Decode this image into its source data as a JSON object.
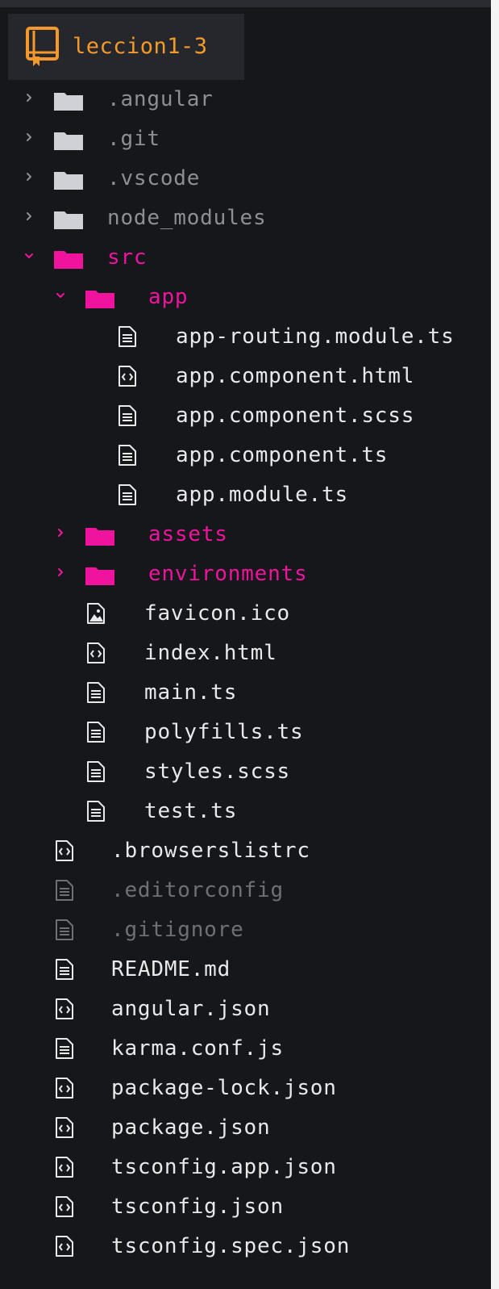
{
  "project": {
    "name": "leccion1-3",
    "icon": "repo-book-icon",
    "accent_color": "#f59a2a"
  },
  "colors": {
    "background": "#16171b",
    "folder_open": "#f0139d",
    "folder_closed": "#8e8f96",
    "file_text": "#e9e9ec",
    "ignored_text": "#6f7077"
  },
  "tree": [
    {
      "label": ".angular",
      "type": "folder",
      "expanded": false,
      "depth": 0,
      "style": "dim"
    },
    {
      "label": ".git",
      "type": "folder",
      "expanded": false,
      "depth": 0,
      "style": "dim"
    },
    {
      "label": ".vscode",
      "type": "folder",
      "expanded": false,
      "depth": 0,
      "style": "dim"
    },
    {
      "label": "node_modules",
      "type": "folder",
      "expanded": false,
      "depth": 0,
      "style": "dim"
    },
    {
      "label": "src",
      "type": "folder",
      "expanded": true,
      "depth": 0,
      "style": "pink"
    },
    {
      "label": "app",
      "type": "folder",
      "expanded": true,
      "depth": 1,
      "style": "pink"
    },
    {
      "label": "app-routing.module.ts",
      "type": "file",
      "icon": "text-file-icon",
      "depth": 2,
      "style": "white"
    },
    {
      "label": "app.component.html",
      "type": "file",
      "icon": "code-file-icon",
      "depth": 2,
      "style": "white"
    },
    {
      "label": "app.component.scss",
      "type": "file",
      "icon": "text-file-icon",
      "depth": 2,
      "style": "white"
    },
    {
      "label": "app.component.ts",
      "type": "file",
      "icon": "text-file-icon",
      "depth": 2,
      "style": "white"
    },
    {
      "label": "app.module.ts",
      "type": "file",
      "icon": "text-file-icon",
      "depth": 2,
      "style": "white"
    },
    {
      "label": "assets",
      "type": "folder",
      "expanded": false,
      "depth": 1,
      "style": "pink"
    },
    {
      "label": "environments",
      "type": "folder",
      "expanded": false,
      "depth": 1,
      "style": "pink"
    },
    {
      "label": "favicon.ico",
      "type": "file",
      "icon": "image-file-icon",
      "depth": 1,
      "style": "white"
    },
    {
      "label": "index.html",
      "type": "file",
      "icon": "code-file-icon",
      "depth": 1,
      "style": "white"
    },
    {
      "label": "main.ts",
      "type": "file",
      "icon": "text-file-icon",
      "depth": 1,
      "style": "white"
    },
    {
      "label": "polyfills.ts",
      "type": "file",
      "icon": "text-file-icon",
      "depth": 1,
      "style": "white"
    },
    {
      "label": "styles.scss",
      "type": "file",
      "icon": "text-file-icon",
      "depth": 1,
      "style": "white"
    },
    {
      "label": "test.ts",
      "type": "file",
      "icon": "text-file-icon",
      "depth": 1,
      "style": "white"
    },
    {
      "label": ".browserslistrc",
      "type": "file",
      "icon": "code-file-icon",
      "depth": 0,
      "style": "white"
    },
    {
      "label": ".editorconfig",
      "type": "file",
      "icon": "text-file-icon",
      "depth": 0,
      "style": "faint"
    },
    {
      "label": ".gitignore",
      "type": "file",
      "icon": "text-file-icon",
      "depth": 0,
      "style": "faint"
    },
    {
      "label": "README.md",
      "type": "file",
      "icon": "text-file-icon",
      "depth": 0,
      "style": "white"
    },
    {
      "label": "angular.json",
      "type": "file",
      "icon": "code-file-icon",
      "depth": 0,
      "style": "white"
    },
    {
      "label": "karma.conf.js",
      "type": "file",
      "icon": "text-file-icon",
      "depth": 0,
      "style": "white"
    },
    {
      "label": "package-lock.json",
      "type": "file",
      "icon": "code-file-icon",
      "depth": 0,
      "style": "white"
    },
    {
      "label": "package.json",
      "type": "file",
      "icon": "code-file-icon",
      "depth": 0,
      "style": "white"
    },
    {
      "label": "tsconfig.app.json",
      "type": "file",
      "icon": "code-file-icon",
      "depth": 0,
      "style": "white"
    },
    {
      "label": "tsconfig.json",
      "type": "file",
      "icon": "code-file-icon",
      "depth": 0,
      "style": "white"
    },
    {
      "label": "tsconfig.spec.json",
      "type": "file",
      "icon": "code-file-icon",
      "depth": 0,
      "style": "white"
    }
  ]
}
